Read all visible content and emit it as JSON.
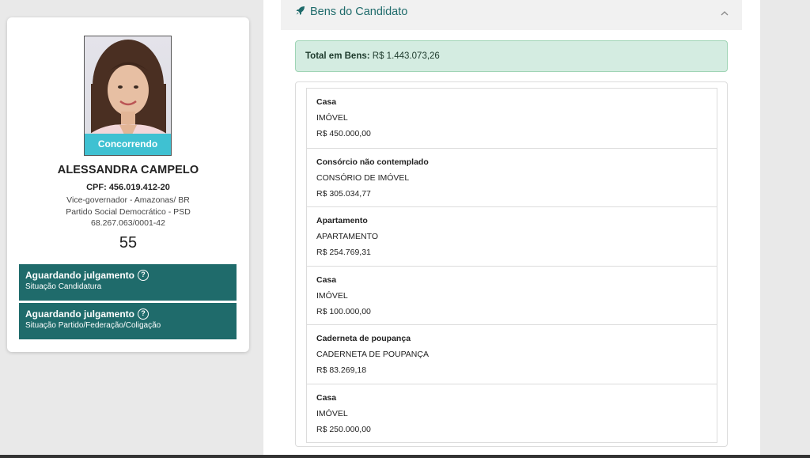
{
  "candidate": {
    "status_badge": "Concorrendo",
    "name": "ALESSANDRA CAMPELO",
    "cpf": "CPF: 456.019.412-20",
    "role": "Vice-governador - Amazonas/ BR",
    "party": "Partido Social Democrático - PSD",
    "cnpj": "68.267.063/0001-42",
    "number": "55"
  },
  "situations": [
    {
      "title": "Aguardando julgamento",
      "subtitle": "Situação Candidatura",
      "icon": "help-circle-icon"
    },
    {
      "title": "Aguardando julgamento",
      "subtitle": "Situação Partido/Federação/Coligação",
      "icon": "help-circle-icon"
    }
  ],
  "assets_section": {
    "title": "Bens do Candidato",
    "icon": "rocket-icon",
    "collapse_icon": "chevron-up-icon",
    "total_label": "Total em Bens:",
    "total_value": "R$ 1.443.073,26",
    "items": [
      {
        "title": "Casa",
        "type": "IMÓVEL",
        "value": "R$ 450.000,00"
      },
      {
        "title": "Consórcio não contemplado",
        "type": "CONSÓRIO DE IMÓVEL",
        "value": "R$ 305.034,77"
      },
      {
        "title": "Apartamento",
        "type": "APARTAMENTO",
        "value": "R$ 254.769,31"
      },
      {
        "title": "Casa",
        "type": "IMÓVEL",
        "value": "R$ 100.000,00"
      },
      {
        "title": "Caderneta de poupança",
        "type": "CADERNETA DE POUPANÇA",
        "value": "R$ 83.269,18"
      },
      {
        "title": "Casa",
        "type": "IMÓVEL",
        "value": "R$ 250.000,00"
      }
    ]
  },
  "colors": {
    "accent": "#1f6b6b",
    "badge": "#3fc1d2",
    "total_bg": "#d4ece1"
  }
}
